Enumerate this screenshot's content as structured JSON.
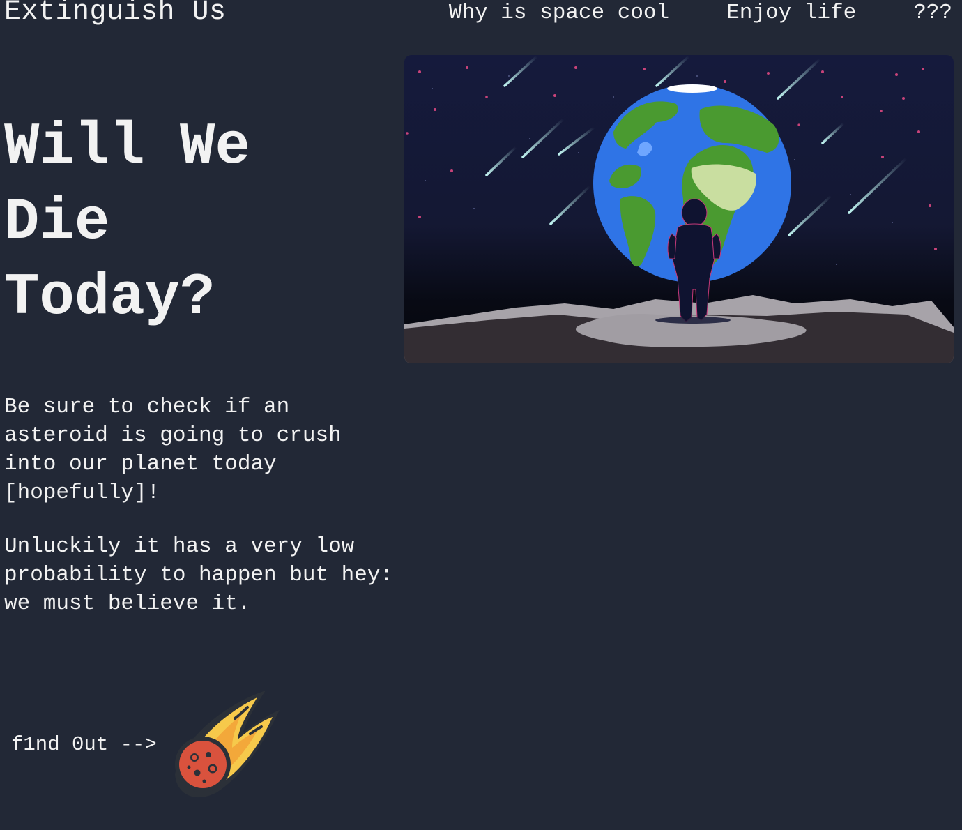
{
  "header": {
    "brand": "Extinguish Us",
    "nav": [
      "Why is space cool",
      "Enjoy life",
      "???"
    ]
  },
  "hero": {
    "title_lines": [
      "Will We",
      "Die",
      "Today?"
    ],
    "paragraphs": [
      "Be sure to check if an asteroid is going to crush into our planet today [hopefully]!",
      "Unluckily it has a very low probability to happen but hey: we must believe it."
    ],
    "cta_label": "f1nd 0ut -->"
  },
  "icons": {
    "cta": "meteor-icon",
    "illustration": "astronaut-earth-illustration"
  },
  "colors": {
    "background": "#222836",
    "text": "#f2f2f2",
    "space": "#141833",
    "earth_ocean": "#2f74e6",
    "earth_land": "#4a9a30",
    "ground": "#9b979c"
  }
}
